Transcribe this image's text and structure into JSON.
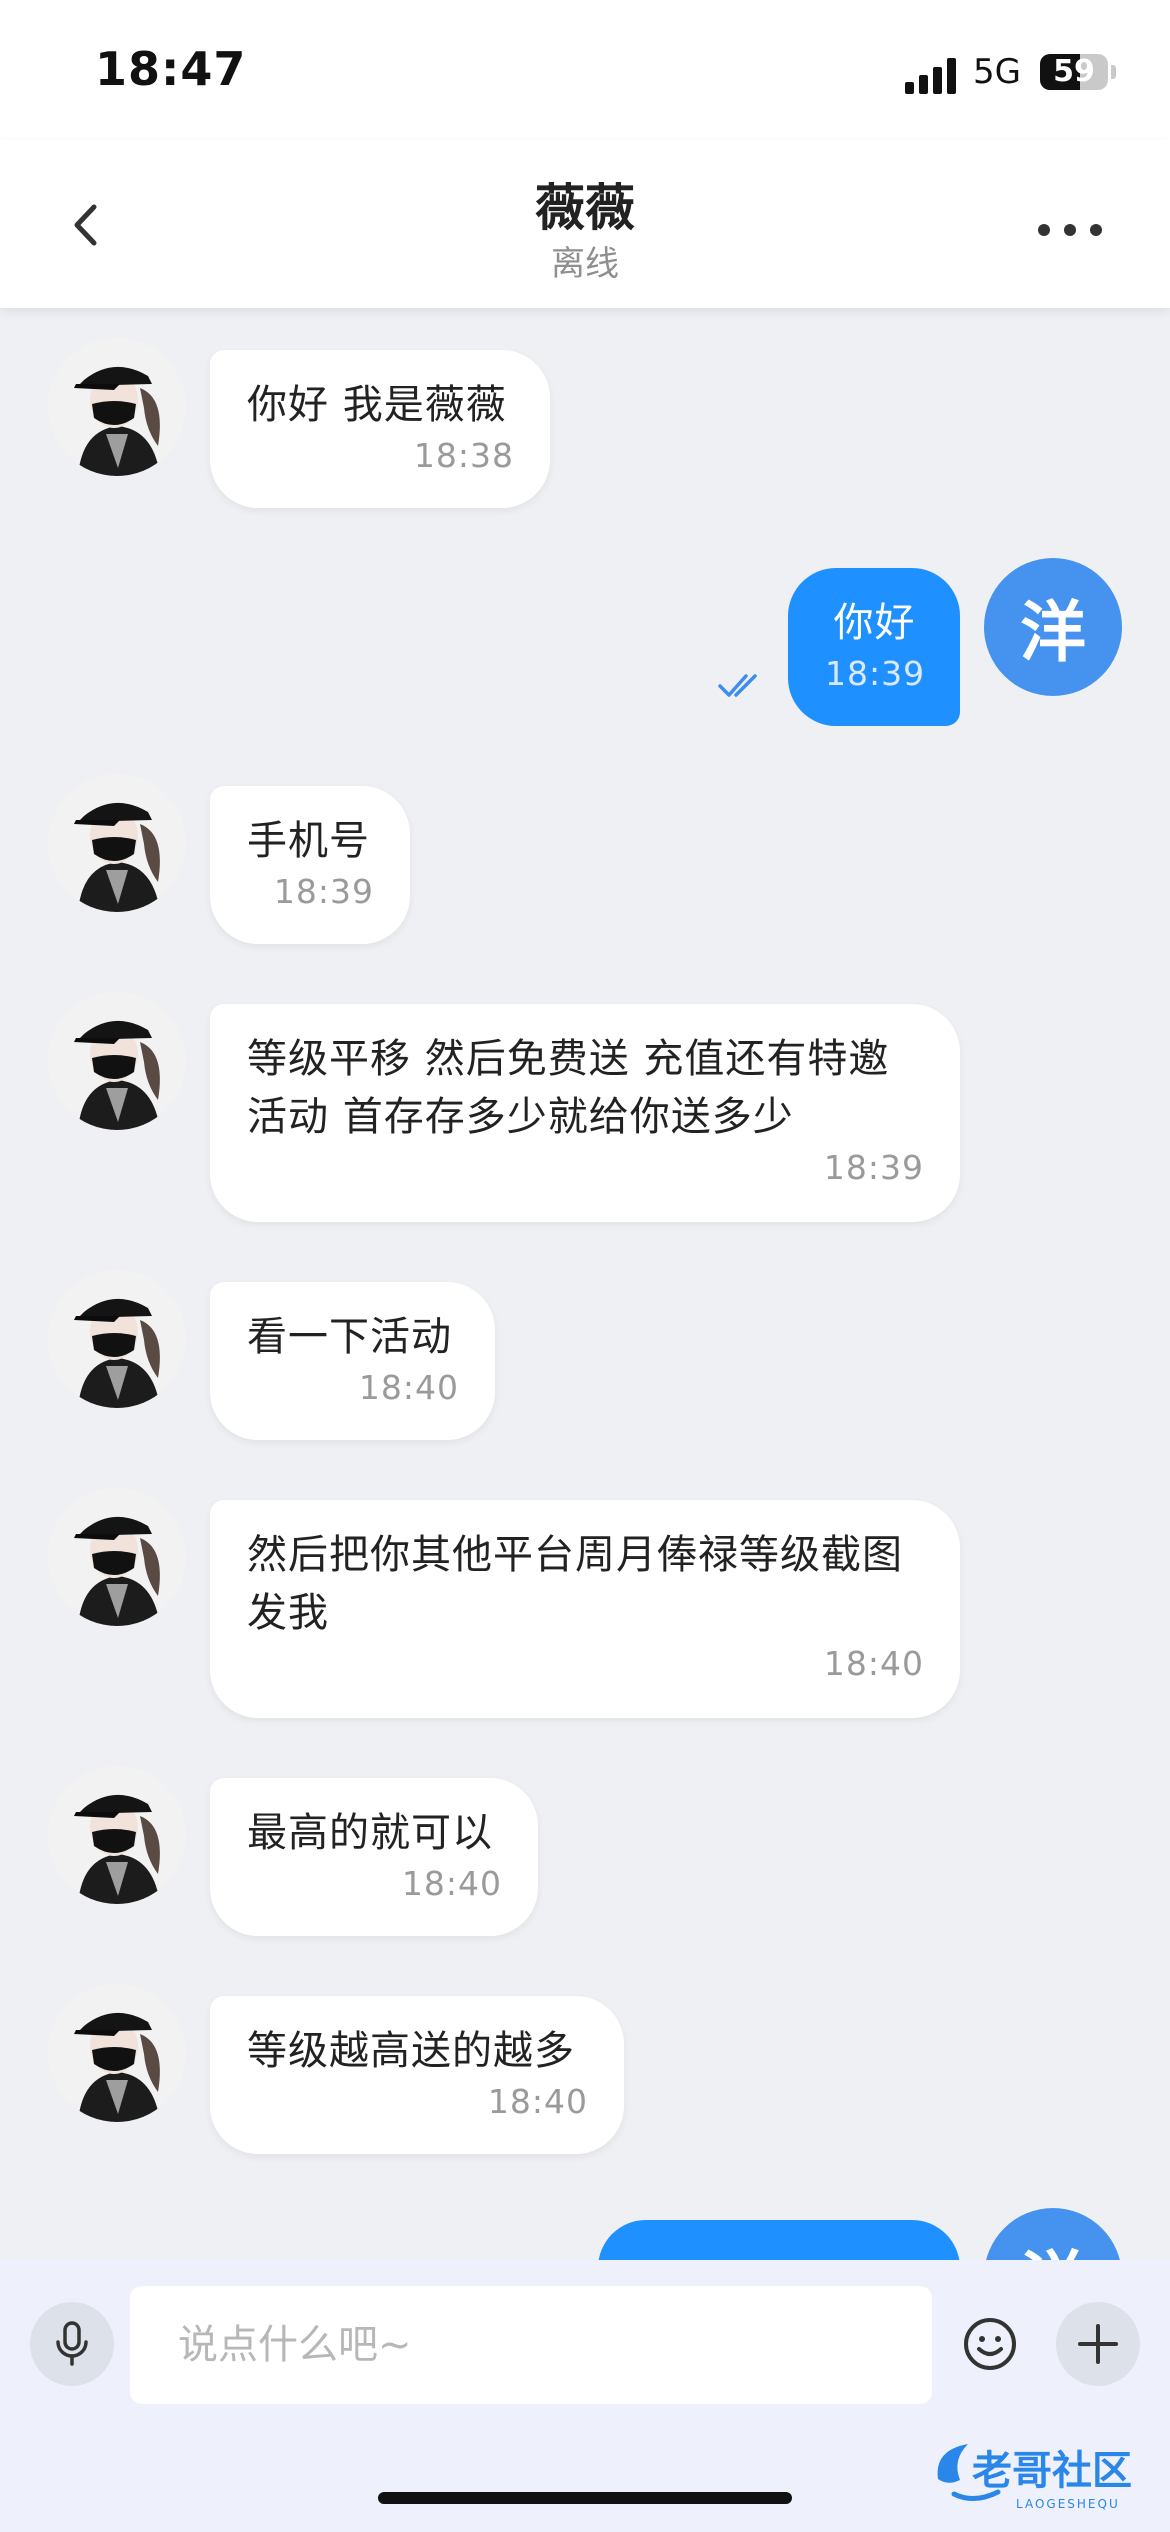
{
  "status_bar": {
    "time": "18:47",
    "network": "5G",
    "battery": "59",
    "battery_level": 0.59
  },
  "header": {
    "title": "薇薇",
    "status": "离线"
  },
  "messages": [
    {
      "side": "in",
      "text": "你好 我是薇薇",
      "time": "18:38"
    },
    {
      "side": "out",
      "text": "你好",
      "time": "18:39",
      "avatar_text": "洋",
      "read": true
    },
    {
      "side": "in",
      "text": "手机号",
      "time": "18:39"
    },
    {
      "side": "in",
      "text": "等级平移 然后免费送 充值还有特邀活动 首存存多少就给你送多少",
      "time": "18:39"
    },
    {
      "side": "in",
      "text": "看一下活动",
      "time": "18:40"
    },
    {
      "side": "in",
      "text": "然后把你其他平台周月俸禄等级截图发我",
      "time": "18:40"
    },
    {
      "side": "in",
      "text": "最高的就可以",
      "time": "18:40"
    },
    {
      "side": "in",
      "text": "等级越高送的越多",
      "time": "18:40"
    },
    {
      "side": "out",
      "text": "",
      "time": "",
      "avatar_text": "洋",
      "partial": true
    }
  ],
  "input": {
    "placeholder": "说点什么吧~"
  },
  "icons": {
    "back": "chevron-left-icon",
    "more": "more-dots-icon",
    "mic": "microphone-icon",
    "emoji": "smiley-icon",
    "plus": "plus-icon",
    "read": "double-check-icon"
  },
  "watermark": {
    "text": "老哥社区",
    "subtext": "LAOGESHEQU"
  },
  "colors": {
    "accent": "#1e90ff",
    "avatar_out": "#4593ee",
    "background": "#eef0f4"
  }
}
